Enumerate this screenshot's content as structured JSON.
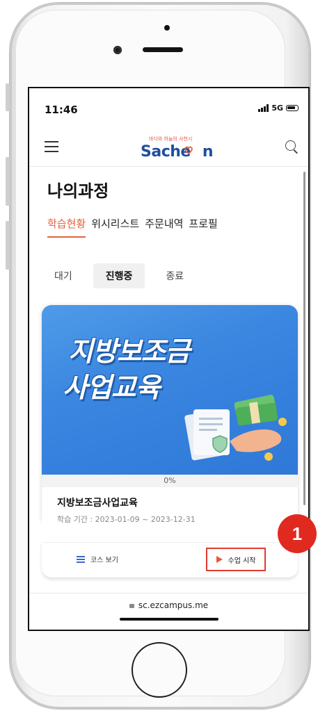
{
  "status": {
    "time": "11:46",
    "network": "5G"
  },
  "appbar": {
    "logo_small": "바다와 하늘의 사천시",
    "logo_text_a": "Sache",
    "logo_text_b": "n"
  },
  "page": {
    "title": "나의과정"
  },
  "tabs": [
    {
      "label": "학습현황",
      "active": true
    },
    {
      "label": "위시리스트",
      "active": false
    },
    {
      "label": "주문내역",
      "active": false
    },
    {
      "label": "프로필",
      "active": false
    }
  ],
  "segments": [
    {
      "label": "대기",
      "active": false
    },
    {
      "label": "진행중",
      "active": true
    },
    {
      "label": "종료",
      "active": false
    }
  ],
  "course": {
    "banner_line1": "지방보조금",
    "banner_line2": "사업교육",
    "progress": "0%",
    "progress_value": 0,
    "title": "지방보조금사업교육",
    "period": "학습 기간 : 2023-01-09 ~ 2023-12-31",
    "view_course_label": "코스 보기",
    "start_label": "수업 시작"
  },
  "browser": {
    "url": "sc.ezcampus.me"
  },
  "annotation": {
    "badge": "1"
  },
  "colors": {
    "accent": "#e8603a",
    "brand": "#1f4f9e",
    "badge": "#e02a20",
    "banner": "#3a86e0"
  }
}
